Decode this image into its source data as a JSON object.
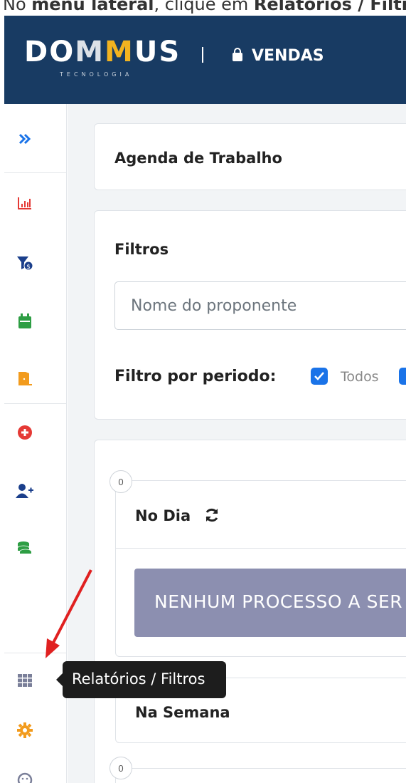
{
  "doc_caption": {
    "prefix": "No ",
    "bold1": "menu lateral",
    "mid": ", clique em ",
    "bold2": "Relatórios / Filtros"
  },
  "header": {
    "logo_part1": "DO",
    "logo_part2": "M",
    "logo_part3": "M",
    "logo_part4": "US",
    "logo_sub": "TECNOLOGIA",
    "module": "VENDAS"
  },
  "sidebar": {
    "icons": [
      "expand-icon",
      "chart-bar-icon",
      "filter-money-icon",
      "calendar-icon",
      "door-exit-icon",
      "plus-circle-icon",
      "user-plus-icon",
      "coins-icon",
      "grid-icon",
      "gear-icon",
      "smiley-icon"
    ]
  },
  "agenda": {
    "title": "Agenda de Trabalho"
  },
  "filters": {
    "title": "Filtros",
    "name_placeholder": "Nome do proponente",
    "period_label": "Filtro por periodo:",
    "option_todos": "Todos"
  },
  "sections": [
    {
      "count": "0",
      "title": "No Dia",
      "empty_message": "NENHUM PROCESSO A SER"
    },
    {
      "title": "Na Semana"
    },
    {
      "count": "0"
    }
  ],
  "tooltip": {
    "text": "Relatórios / Filtros"
  },
  "colors": {
    "header_bg": "#183b63",
    "accent_yellow": "#f2b320",
    "checkbox_blue": "#1a73e8",
    "empty_box": "#8c8fb0",
    "annotation_red": "#e02020"
  }
}
